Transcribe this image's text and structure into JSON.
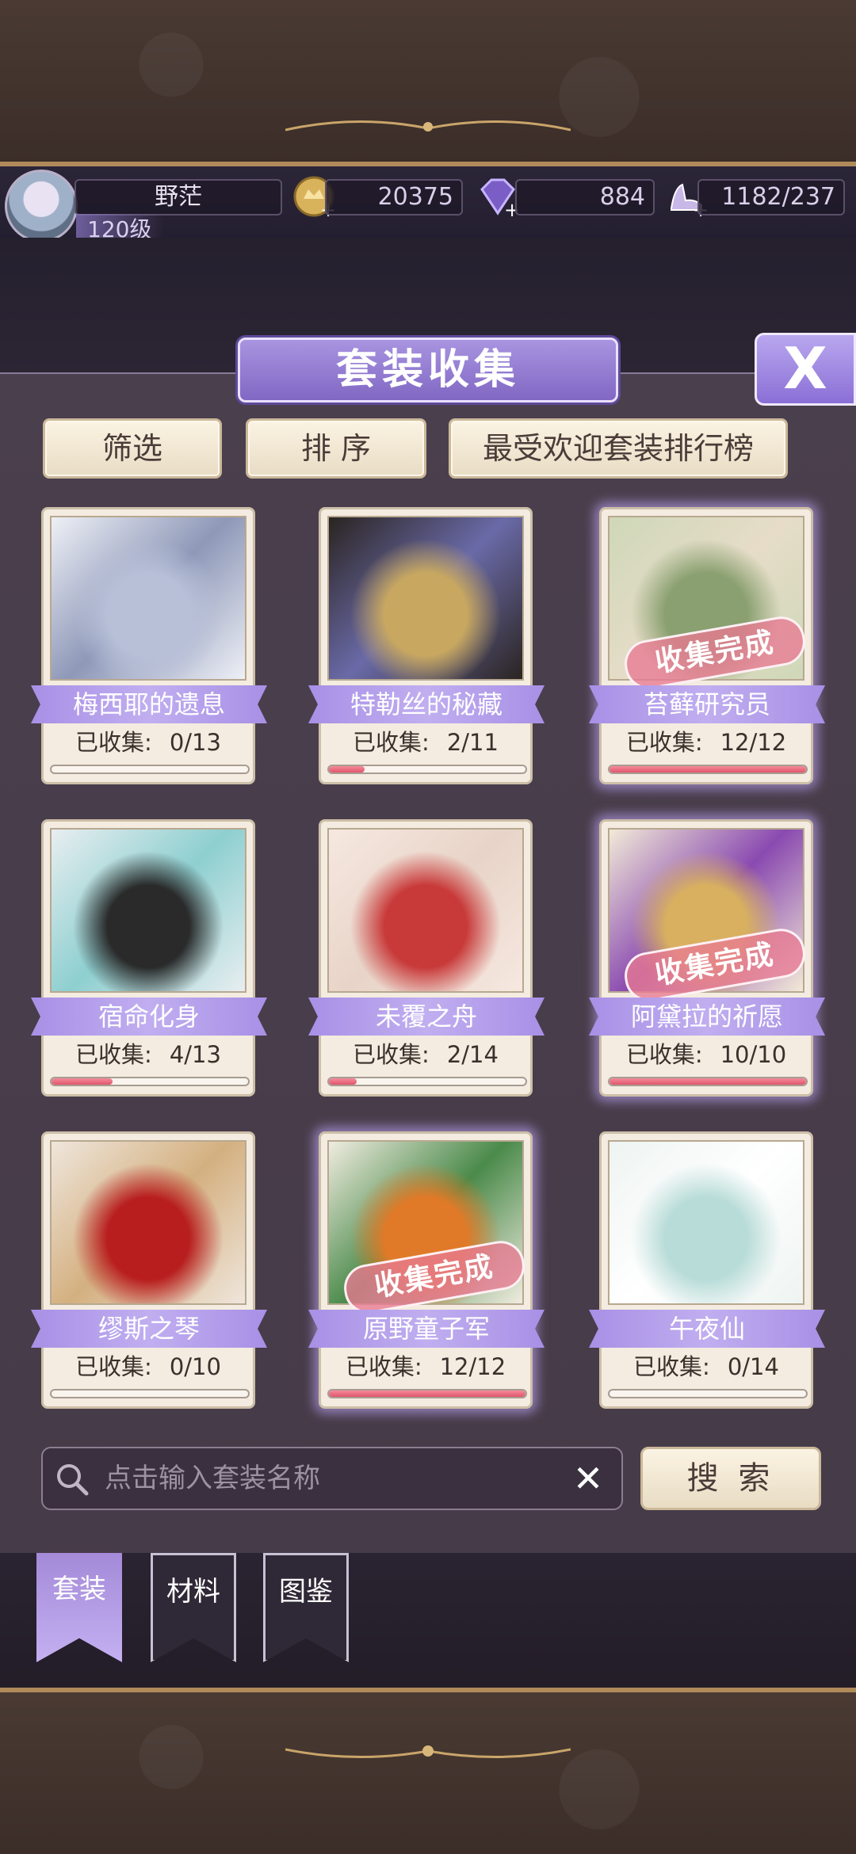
{
  "player": {
    "name": "野茫",
    "level": "120级"
  },
  "resources": {
    "coins": "20375",
    "diamonds": "884",
    "stamina": "1182/237"
  },
  "panel": {
    "title": "套装收集",
    "close_label": "X"
  },
  "toolbar": {
    "filter_label": "筛选",
    "sort_label": "排 序",
    "ranking_label": "最受欢迎套装排行榜"
  },
  "cards": [
    {
      "name": "梅西耶的遗息",
      "progress_label": "已收集:",
      "progress": "0/13",
      "fraction": 0.0,
      "complete": false
    },
    {
      "name": "特勒丝的秘藏",
      "progress_label": "已收集:",
      "progress": "2/11",
      "fraction": 0.18,
      "complete": false
    },
    {
      "name": "苔藓研究员",
      "progress_label": "已收集:",
      "progress": "12/12",
      "fraction": 1.0,
      "complete": true
    },
    {
      "name": "宿命化身",
      "progress_label": "已收集:",
      "progress": "4/13",
      "fraction": 0.31,
      "complete": false
    },
    {
      "name": "未覆之舟",
      "progress_label": "已收集:",
      "progress": "2/14",
      "fraction": 0.14,
      "complete": false
    },
    {
      "name": "阿黛拉的祈愿",
      "progress_label": "已收集:",
      "progress": "10/10",
      "fraction": 1.0,
      "complete": true
    },
    {
      "name": "缪斯之琴",
      "progress_label": "已收集:",
      "progress": "0/10",
      "fraction": 0.0,
      "complete": false
    },
    {
      "name": "原野童子军",
      "progress_label": "已收集:",
      "progress": "12/12",
      "fraction": 1.0,
      "complete": true
    },
    {
      "name": "午夜仙",
      "progress_label": "已收集:",
      "progress": "0/14",
      "fraction": 0.0,
      "complete": false
    }
  ],
  "stamp_label": "收集完成",
  "search": {
    "placeholder": "点击输入套装名称",
    "button_label": "搜 索"
  },
  "tabs": [
    {
      "label": "套装",
      "active": true
    },
    {
      "label": "材料",
      "active": false
    },
    {
      "label": "图鉴",
      "active": false
    }
  ],
  "colors": {
    "accent_purple": "#9a80dc",
    "progress_pink": "#e0566c",
    "card_bg": "#f4ece0"
  }
}
